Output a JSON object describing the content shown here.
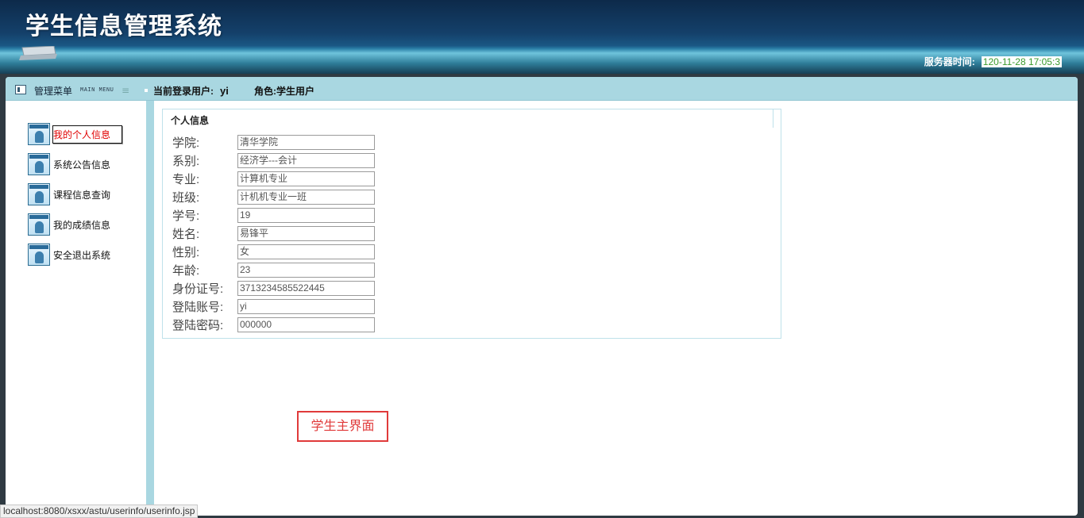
{
  "header": {
    "title": "学生信息管理系统",
    "server_time_label": "服务器时间:",
    "server_time_value": "120-11-28 17:05:3"
  },
  "bar": {
    "menu_title": "管理菜单",
    "menu_sub": "MAIN MENU",
    "user_label": "当前登录用户:",
    "user_name": "yi",
    "role_label": "角色:",
    "role_value": "学生用户"
  },
  "sidebar": {
    "items": [
      {
        "label": "我的个人信息"
      },
      {
        "label": "系统公告信息"
      },
      {
        "label": "课程信息查询"
      },
      {
        "label": "我的成绩信息"
      },
      {
        "label": "安全退出系统"
      }
    ]
  },
  "profile": {
    "legend": "个人信息",
    "fields": [
      {
        "label": "学院:",
        "value": "清华学院"
      },
      {
        "label": "系别:",
        "value": "经济学---会计"
      },
      {
        "label": "专业:",
        "value": "计算机专业"
      },
      {
        "label": "班级:",
        "value": "计机机专业一班"
      },
      {
        "label": "学号:",
        "value": "19"
      },
      {
        "label": "姓名:",
        "value": "易锋平"
      },
      {
        "label": "性别:",
        "value": "女"
      },
      {
        "label": "年龄:",
        "value": "23"
      },
      {
        "label": "身份证号:",
        "value": "3713234585522445"
      },
      {
        "label": "登陆账号:",
        "value": "yi"
      },
      {
        "label": "登陆密码:",
        "value": "000000"
      }
    ]
  },
  "annotation": "学生主界面",
  "status_url": "localhost:8080/xsxx/astu/userinfo/userinfo.jsp",
  "colors": {
    "header_dark": "#0d2a4a",
    "bar_bg": "#a9d7e1",
    "active_link": "#e00000",
    "annotation": "#e03a3a",
    "time_value": "#3a9a2c"
  }
}
